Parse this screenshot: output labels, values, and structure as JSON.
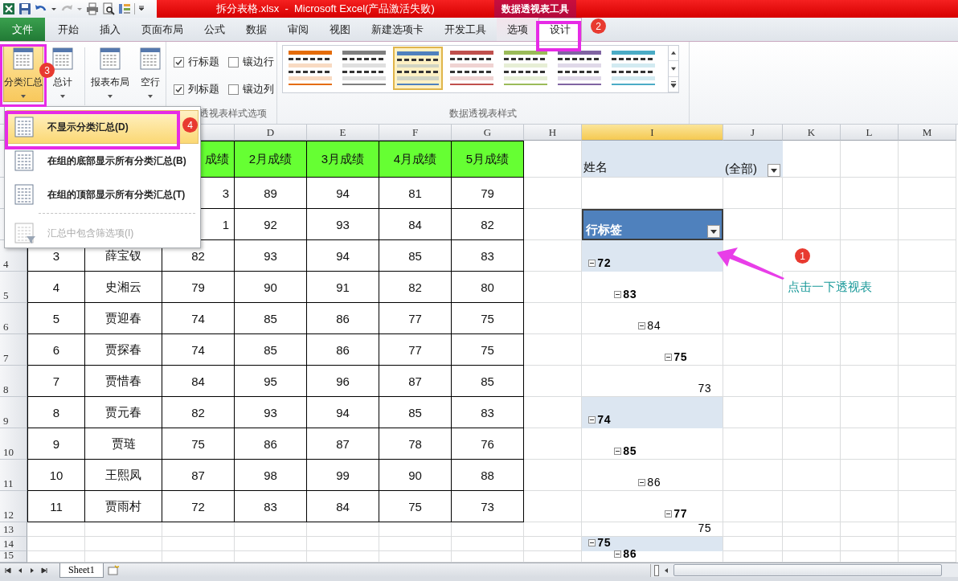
{
  "window": {
    "title": "拆分表格.xlsx  -  Microsoft Excel(产品激活失败)",
    "context_label": "数据透视表工具"
  },
  "tabs": [
    {
      "label": "文件",
      "kind": "file",
      "selected": false
    },
    {
      "label": "开始",
      "kind": "tab",
      "selected": false
    },
    {
      "label": "插入",
      "kind": "tab",
      "selected": false
    },
    {
      "label": "页面布局",
      "kind": "tab",
      "selected": false
    },
    {
      "label": "公式",
      "kind": "tab",
      "selected": false
    },
    {
      "label": "数据",
      "kind": "tab",
      "selected": false
    },
    {
      "label": "审阅",
      "kind": "tab",
      "selected": false
    },
    {
      "label": "视图",
      "kind": "tab",
      "selected": false
    },
    {
      "label": "新建选项卡",
      "kind": "tab",
      "selected": false
    },
    {
      "label": "开发工具",
      "kind": "tab",
      "selected": false
    },
    {
      "label": "选项",
      "kind": "context",
      "selected": false
    },
    {
      "label": "设计",
      "kind": "context",
      "selected": true
    }
  ],
  "ribbon": {
    "buttons": [
      {
        "label": "分类汇总",
        "expanded": true
      },
      {
        "label": "总计",
        "expanded": false
      },
      {
        "label": "报表布局",
        "expanded": false
      },
      {
        "label": "空行",
        "expanded": false
      }
    ],
    "checkboxes": [
      {
        "label": "行标题",
        "checked": true
      },
      {
        "label": "镶边行",
        "checked": false
      },
      {
        "label": "列标题",
        "checked": true
      },
      {
        "label": "镶边列",
        "checked": false
      }
    ],
    "options_group_label": "透视表样式选项",
    "styles": [
      {
        "color": "#e46c0a",
        "selected": false
      },
      {
        "color": "#7f7f7f",
        "selected": false
      },
      {
        "color": "#4f81bd",
        "selected": true
      },
      {
        "color": "#c0504d",
        "selected": false
      },
      {
        "color": "#9bbb59",
        "selected": false
      },
      {
        "color": "#8064a2",
        "selected": false
      },
      {
        "color": "#4bacc6",
        "selected": false
      }
    ],
    "styles_group_label": "数据透视表样式"
  },
  "menu": {
    "items": [
      {
        "kind": "item",
        "label": "不显示分类汇总(D)",
        "selected": true,
        "disabled": false
      },
      {
        "kind": "item",
        "label": "在组的底部显示所有分类汇总(B)",
        "selected": false,
        "disabled": false
      },
      {
        "kind": "item",
        "label": "在组的顶部显示所有分类汇总(T)",
        "selected": false,
        "disabled": false
      },
      {
        "kind": "separator"
      },
      {
        "kind": "item",
        "label": "汇总中包含筛选项(I)",
        "selected": false,
        "disabled": true
      }
    ]
  },
  "sheet": {
    "column_headers": [
      {
        "label": "D",
        "selected": false
      },
      {
        "label": "E",
        "selected": false
      },
      {
        "label": "F",
        "selected": false
      },
      {
        "label": "G",
        "selected": false
      },
      {
        "label": "H",
        "selected": false
      },
      {
        "label": "I",
        "selected": true
      },
      {
        "label": "J",
        "selected": false
      },
      {
        "label": "K",
        "selected": false
      },
      {
        "label": "L",
        "selected": false
      },
      {
        "label": "M",
        "selected": false
      }
    ],
    "row_headers": [
      "4",
      "5",
      "6",
      "7",
      "8",
      "9",
      "10",
      "11",
      "12",
      "13",
      "14",
      "15"
    ],
    "table": {
      "header": {
        "partial": "成绩",
        "columns": [
          "2月成绩",
          "3月成绩",
          "4月成绩",
          "5月成绩"
        ]
      },
      "rows": [
        {
          "partial": "3",
          "scores": [
            "89",
            "94",
            "81",
            "79"
          ]
        },
        {
          "partial": "1",
          "scores": [
            "92",
            "93",
            "84",
            "82"
          ]
        },
        {
          "no": "3",
          "name": "薛宝钗",
          "scores": [
            "82",
            "93",
            "94",
            "85",
            "83"
          ]
        },
        {
          "no": "4",
          "name": "史湘云",
          "scores": [
            "79",
            "90",
            "91",
            "82",
            "80"
          ]
        },
        {
          "no": "5",
          "name": "贾迎春",
          "scores": [
            "74",
            "85",
            "86",
            "77",
            "75"
          ]
        },
        {
          "no": "6",
          "name": "贾探春",
          "scores": [
            "74",
            "85",
            "86",
            "77",
            "75"
          ]
        },
        {
          "no": "7",
          "name": "贾惜春",
          "scores": [
            "84",
            "95",
            "96",
            "87",
            "85"
          ]
        },
        {
          "no": "8",
          "name": "贾元春",
          "scores": [
            "82",
            "93",
            "94",
            "85",
            "83"
          ]
        },
        {
          "no": "9",
          "name": "贾琏",
          "scores": [
            "75",
            "86",
            "87",
            "78",
            "76"
          ]
        },
        {
          "no": "10",
          "name": "王熙凤",
          "scores": [
            "87",
            "98",
            "99",
            "90",
            "88"
          ]
        },
        {
          "no": "11",
          "name": "贾雨村",
          "scores": [
            "72",
            "83",
            "84",
            "75",
            "73"
          ]
        }
      ]
    },
    "pivot": {
      "filter": {
        "label": "姓名",
        "value": "(全部)"
      },
      "row_label": "行标签",
      "items": [
        {
          "label": "72",
          "expanded": true,
          "children": [
            {
              "label": "83",
              "expanded": true,
              "children": [
                {
                  "label": "84",
                  "expanded": true,
                  "children": [
                    {
                      "label": "75",
                      "expanded": true,
                      "children": [
                        {
                          "label": "73"
                        }
                      ]
                    }
                  ]
                }
              ]
            }
          ]
        },
        {
          "label": "74",
          "expanded": true,
          "children": [
            {
              "label": "85",
              "expanded": true,
              "children": [
                {
                  "label": "86",
                  "expanded": true,
                  "children": [
                    {
                      "label": "77",
                      "expanded": true,
                      "children": [
                        {
                          "label": "75"
                        }
                      ]
                    }
                  ]
                }
              ]
            }
          ]
        },
        {
          "label": "75",
          "expanded": true,
          "children": [
            {
              "label": "86",
              "expanded": true
            }
          ]
        }
      ]
    }
  },
  "sheet_tabs": [
    {
      "label": "Sheet1",
      "selected": true
    }
  ],
  "annotations": {
    "step_badges": [
      "2",
      "3",
      "4",
      "1"
    ],
    "note": "点击一下透视表"
  }
}
